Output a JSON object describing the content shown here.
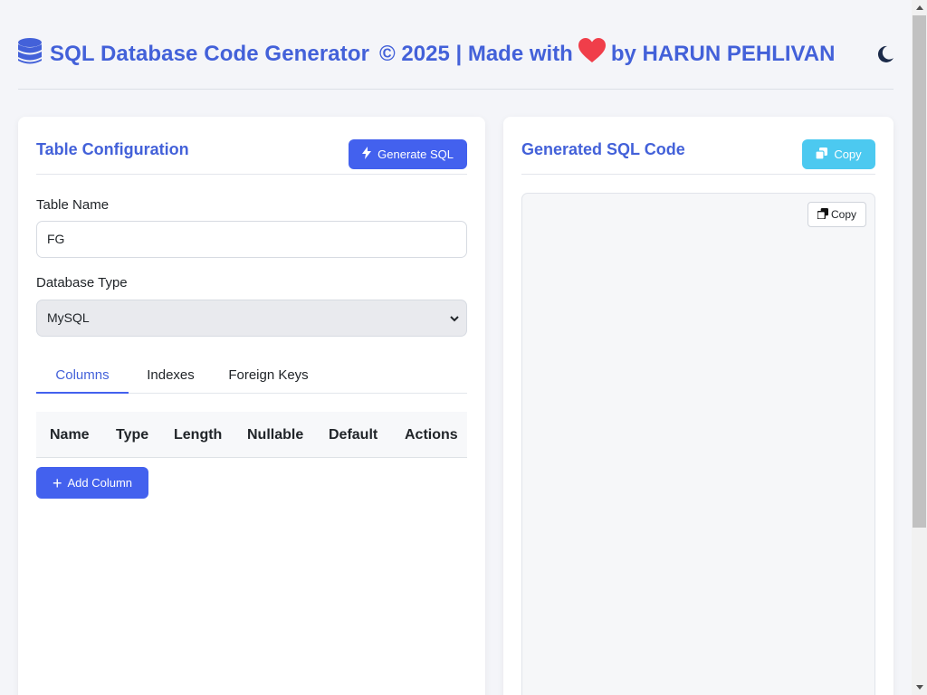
{
  "header": {
    "title": "SQL Database Code Generator",
    "copyright": "© 2025 | Made with",
    "byline": "by HARUN PEHLIVAN",
    "icons": {
      "brand": "database-icon",
      "heart": "heart-icon",
      "theme": "moon-icon"
    }
  },
  "colors": {
    "accent": "#4361ee",
    "title": "#4361d9",
    "copy_button": "#4cc9f0",
    "heart": "#f03e4a",
    "moon": "#1c2b4a"
  },
  "config": {
    "title": "Table Configuration",
    "generate_label": "Generate SQL",
    "table_name_label": "Table Name",
    "table_name_value": "FG",
    "db_type_label": "Database Type",
    "db_type_value": "MySQL",
    "tabs": [
      "Columns",
      "Indexes",
      "Foreign Keys"
    ],
    "active_tab": "Columns",
    "columns_header": [
      "Name",
      "Type",
      "Length",
      "Nullable",
      "Default",
      "Actions"
    ],
    "add_column_label": "Add Column"
  },
  "output": {
    "title": "Generated SQL Code",
    "copy_label": "Copy",
    "inner_copy_label": "Copy",
    "code": ""
  }
}
